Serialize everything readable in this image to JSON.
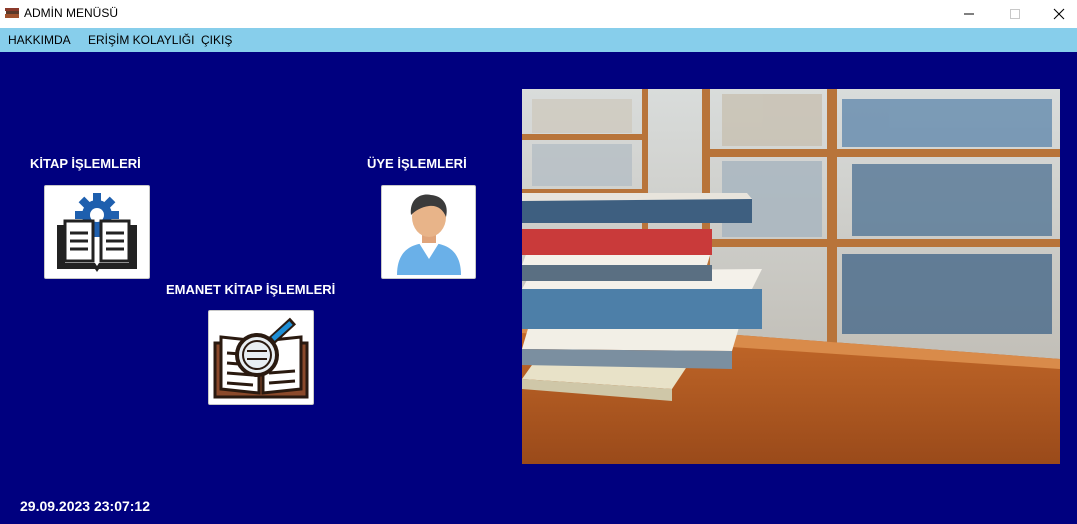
{
  "window": {
    "title": "ADMİN MENÜSÜ"
  },
  "menu": {
    "items": [
      {
        "label": "HAKKIMDA"
      },
      {
        "label": "ERİŞİM KOLAYLIĞI"
      },
      {
        "label": "ÇIKIŞ"
      }
    ]
  },
  "main": {
    "book_ops_label": "KİTAP İŞLEMLERİ",
    "member_ops_label": "ÜYE İŞLEMLERİ",
    "loan_ops_label": "EMANET KİTAP İŞLEMLERİ",
    "datetime": "29.09.2023 23:07:12"
  },
  "colors": {
    "background": "#00007f",
    "menubar": "#87ceeb"
  },
  "icons": {
    "book_ops": "book-gear-icon",
    "member_ops": "user-avatar-icon",
    "loan_ops": "book-magnifier-icon"
  }
}
